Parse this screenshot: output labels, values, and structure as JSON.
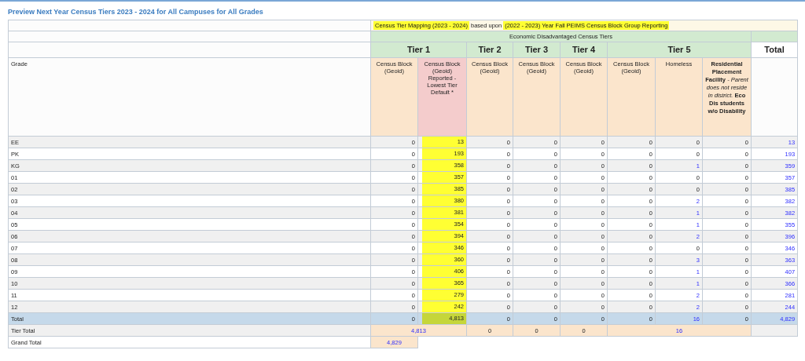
{
  "title": "Preview Next Year Census Tiers 2023 - 2024 for All Campuses for All Grades",
  "mapping_note": [
    {
      "text": "Census Tier Mapping (2023 - 2024)",
      "highlighted": true
    },
    {
      "text": "based upon",
      "highlighted": false
    },
    {
      "text": "(2022 - 2023) Year Fall PEIMS Census Block Group Reporting",
      "highlighted": true
    }
  ],
  "group_heading": "Economic Disadvantaged Census Tiers",
  "tiers": [
    {
      "label": "Tier 1",
      "columns": [
        {
          "label": "Census Block (Geoid)",
          "kind": "plain"
        },
        {
          "label": "Census Block (Geoid) Reported - Lowest Tier Default *",
          "kind": "default"
        }
      ],
      "tier_total": {
        "value": "4,813",
        "link": true
      }
    },
    {
      "label": "Tier 2",
      "columns": [
        {
          "label": "Census Block (Geoid)",
          "kind": "plain"
        }
      ],
      "tier_total": {
        "value": "0",
        "link": false
      }
    },
    {
      "label": "Tier 3",
      "columns": [
        {
          "label": "Census Block (Geoid)",
          "kind": "plain"
        }
      ],
      "tier_total": {
        "value": "0",
        "link": false
      }
    },
    {
      "label": "Tier 4",
      "columns": [
        {
          "label": "Census Block (Geoid)",
          "kind": "plain"
        }
      ],
      "tier_total": {
        "value": "0",
        "link": false
      }
    },
    {
      "label": "Tier 5",
      "columns": [
        {
          "label": "Census Block (Geoid)",
          "kind": "plain"
        },
        {
          "label": "Homeless",
          "kind": "homeless"
        },
        {
          "label": "**Residential Placement Facility** *- Parent does not reside in district.* **Eco Dis students w/o Disability**",
          "kind": "rich"
        }
      ],
      "tier_total": {
        "value": "16",
        "link": true
      }
    }
  ],
  "total_heading": "Total",
  "grade_heading": "Grade",
  "rows": [
    {
      "grade": "EE",
      "kind": "grade",
      "values": [
        "0",
        "13",
        "0",
        "0",
        "0",
        "0",
        "0",
        "0"
      ],
      "homeless_linked": false,
      "total": "13"
    },
    {
      "grade": "PK",
      "kind": "grade",
      "values": [
        "0",
        "193",
        "0",
        "0",
        "0",
        "0",
        "0",
        "0"
      ],
      "homeless_linked": false,
      "total": "193"
    },
    {
      "grade": "KG",
      "kind": "grade",
      "values": [
        "0",
        "358",
        "0",
        "0",
        "0",
        "0",
        "1",
        "0"
      ],
      "homeless_linked": true,
      "total": "359"
    },
    {
      "grade": "01",
      "kind": "grade",
      "values": [
        "0",
        "357",
        "0",
        "0",
        "0",
        "0",
        "0",
        "0"
      ],
      "homeless_linked": false,
      "total": "357"
    },
    {
      "grade": "02",
      "kind": "grade",
      "values": [
        "0",
        "385",
        "0",
        "0",
        "0",
        "0",
        "0",
        "0"
      ],
      "homeless_linked": false,
      "total": "385"
    },
    {
      "grade": "03",
      "kind": "grade",
      "values": [
        "0",
        "380",
        "0",
        "0",
        "0",
        "0",
        "2",
        "0"
      ],
      "homeless_linked": true,
      "total": "382"
    },
    {
      "grade": "04",
      "kind": "grade",
      "values": [
        "0",
        "381",
        "0",
        "0",
        "0",
        "0",
        "1",
        "0"
      ],
      "homeless_linked": true,
      "total": "382"
    },
    {
      "grade": "05",
      "kind": "grade",
      "values": [
        "0",
        "354",
        "0",
        "0",
        "0",
        "0",
        "1",
        "0"
      ],
      "homeless_linked": true,
      "total": "355"
    },
    {
      "grade": "06",
      "kind": "grade",
      "values": [
        "0",
        "394",
        "0",
        "0",
        "0",
        "0",
        "2",
        "0"
      ],
      "homeless_linked": true,
      "total": "396"
    },
    {
      "grade": "07",
      "kind": "grade",
      "values": [
        "0",
        "346",
        "0",
        "0",
        "0",
        "0",
        "0",
        "0"
      ],
      "homeless_linked": false,
      "total": "346"
    },
    {
      "grade": "08",
      "kind": "grade",
      "values": [
        "0",
        "360",
        "0",
        "0",
        "0",
        "0",
        "3",
        "0"
      ],
      "homeless_linked": true,
      "total": "363"
    },
    {
      "grade": "09",
      "kind": "grade",
      "values": [
        "0",
        "406",
        "0",
        "0",
        "0",
        "0",
        "1",
        "0"
      ],
      "homeless_linked": true,
      "total": "407"
    },
    {
      "grade": "10",
      "kind": "grade",
      "values": [
        "0",
        "365",
        "0",
        "0",
        "0",
        "0",
        "1",
        "0"
      ],
      "homeless_linked": true,
      "total": "366"
    },
    {
      "grade": "11",
      "kind": "grade",
      "values": [
        "0",
        "279",
        "0",
        "0",
        "0",
        "0",
        "2",
        "0"
      ],
      "homeless_linked": true,
      "total": "281"
    },
    {
      "grade": "12",
      "kind": "grade",
      "values": [
        "0",
        "242",
        "0",
        "0",
        "0",
        "0",
        "2",
        "0"
      ],
      "homeless_linked": true,
      "total": "244"
    },
    {
      "grade": "Total",
      "kind": "total",
      "values": [
        "0",
        "4,813",
        "0",
        "0",
        "0",
        "0",
        "16",
        "0"
      ],
      "homeless_linked": true,
      "total": "4,829"
    }
  ],
  "tier_total_label": "Tier Total",
  "grand_total": {
    "label": "Grand Total",
    "value": "4,829"
  }
}
